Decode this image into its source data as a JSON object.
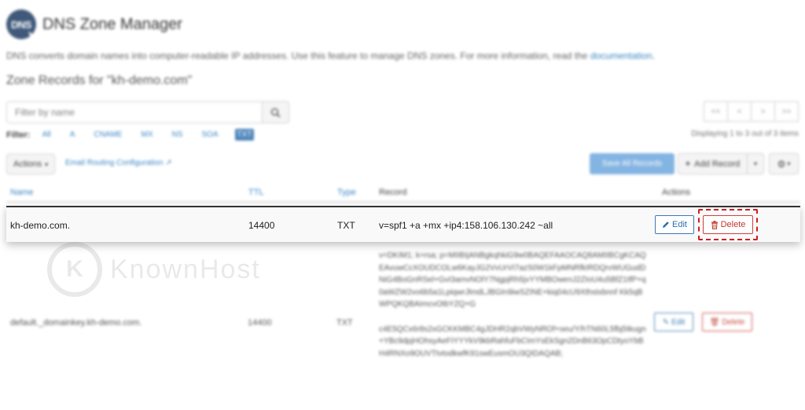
{
  "app": {
    "logo_text": "DNS",
    "title": "DNS Zone Manager"
  },
  "description": {
    "text": "DNS converts domain names into computer-readable IP addresses. Use this feature to manage DNS zones. For more information, read the ",
    "link": "documentation",
    "suffix": "."
  },
  "zone_title": "Zone Records for \"kh-demo.com\"",
  "search": {
    "placeholder": "Filter by name"
  },
  "pager": {
    "first": "<<",
    "prev": "<",
    "next": ">",
    "last": ">>",
    "status": "Displaying 1 to 3 out of 3 items"
  },
  "filters": {
    "label": "Filter:",
    "items": [
      "All",
      "A",
      "CNAME",
      "MX",
      "NS",
      "SOA",
      "TXT"
    ],
    "active": "TXT"
  },
  "toolbar": {
    "actions_label": "Actions",
    "email_routing": "Email Routing Configuration",
    "save_all": "Save All Records",
    "add_record": "Add Record"
  },
  "table": {
    "headers": {
      "name": "Name",
      "ttl": "TTL",
      "type": "Type",
      "record": "Record",
      "actions": "Actions"
    },
    "rows": [
      {
        "name": "kh-demo.com.",
        "ttl": "14400",
        "type": "TXT",
        "record": "v=spf1 +a +mx +ip4:158.106.130.242 ~all",
        "edit": "Edit",
        "delete": "Delete"
      },
      {
        "name": "default._domainkey.kh-demo.com.",
        "ttl": "14400",
        "type": "TXT",
        "record_part1": "v=DKIM1; k=rsa; p=MIIBIjANBgkqhkiG9w0BAQEFAAOCAQ8AMIIBCgKCAQEAvuwCcXOUDCOLw6KayJG2VvUrVI7azS0W1kFpMNRfkIRDQrvWUGudDNiG4BoGnRSel+GvI3amvNOlY7NgpjRh5jvYYMBOwenJ2ZIoU4u5BfZ1tfP+q0aWZW2vo6b5a1LpiqwrJlmdLJBGIn9iwSZINE+kiq04cU9Xthstxbnnf Kk5qBWPQKQBAImcvOtbYZQ+G",
        "record_part2": "c4E5QCx6r8s2xGCKKMBC4gJDHR2qbVWyNROf+seu/Y/hTN60L5fbj5tkugn+YBc9dpjHOhsyAeFIYYYkV9kbRahfuFbCImYsEkSgn2DnB63OpCDtyoYbBH4RNXo9OUVTtvtodkwfK91swEusmOU3QIDAQAB;",
        "edit": "Edit",
        "delete": "Delete"
      }
    ]
  },
  "watermark": {
    "glyph": "K",
    "text": "KnownHost"
  },
  "colors": {
    "primary": "#3d79b5",
    "danger": "#c0392b",
    "highlight_outline": "#cc1f1f"
  },
  "icons": [
    "search-icon",
    "external-link-icon",
    "gear-icon",
    "pencil-icon",
    "trash-icon",
    "chevron-down-icon",
    "plus-icon"
  ]
}
